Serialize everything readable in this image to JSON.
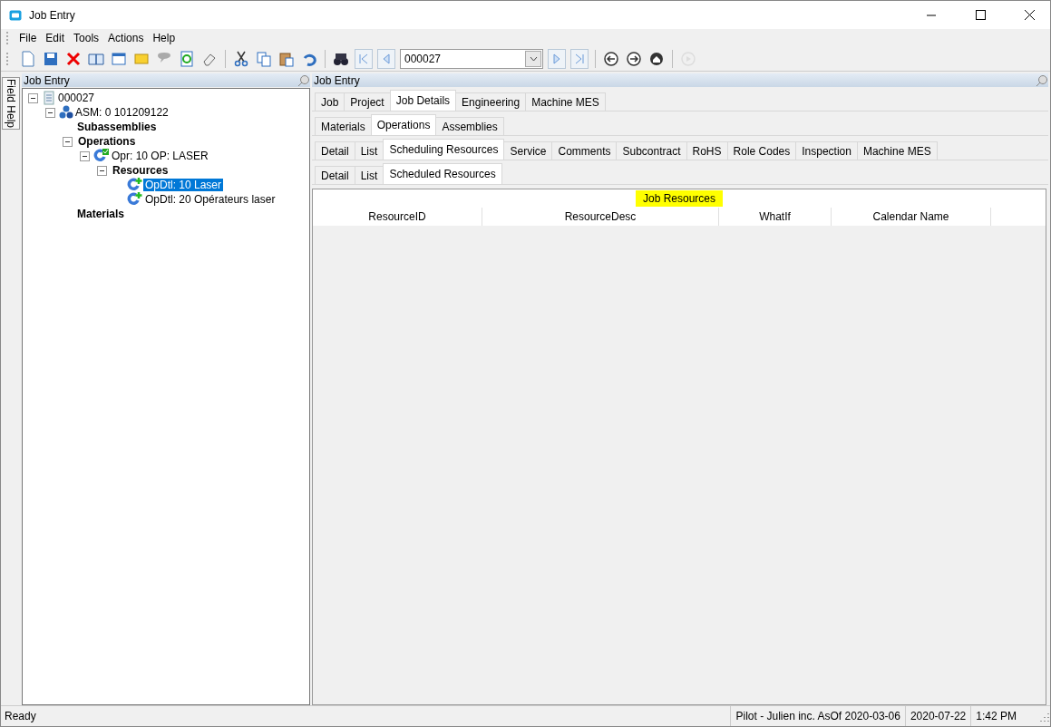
{
  "window": {
    "title": "Job Entry"
  },
  "menu": [
    "File",
    "Edit",
    "Tools",
    "Actions",
    "Help"
  ],
  "navigator": {
    "value": "000027"
  },
  "side_tab": "Field Help",
  "left_panel": {
    "title": "Job Entry",
    "tree": [
      {
        "label": "000027",
        "kind": "job",
        "selected": false,
        "expanded": true,
        "children": [
          {
            "label": "ASM: 0 101209122",
            "kind": "assembly",
            "selected": false,
            "expanded": true,
            "children": [
              {
                "label": "Subassemblies",
                "kind": "group",
                "selected": false
              },
              {
                "label": "Operations",
                "kind": "group",
                "selected": false,
                "expanded": true,
                "children": [
                  {
                    "label": "Opr: 10 OP: LASER",
                    "kind": "operation",
                    "selected": false,
                    "expanded": true,
                    "children": [
                      {
                        "label": "Resources",
                        "kind": "group",
                        "selected": false,
                        "expanded": true,
                        "children": [
                          {
                            "label": "OpDtl: 10 Laser",
                            "kind": "detail",
                            "selected": true
                          },
                          {
                            "label": "OpDtl: 20 Opérateurs laser",
                            "kind": "detail",
                            "selected": false
                          }
                        ]
                      }
                    ]
                  }
                ]
              },
              {
                "label": "Materials",
                "kind": "group",
                "selected": false
              }
            ]
          }
        ]
      }
    ]
  },
  "right_panel": {
    "title": "Job Entry",
    "tab_rows": [
      [
        {
          "label": "Job",
          "selected": false
        },
        {
          "label": "Project",
          "selected": false
        },
        {
          "label": "Job Details",
          "selected": true
        },
        {
          "label": "Engineering",
          "selected": false
        },
        {
          "label": "Machine MES",
          "selected": false
        }
      ],
      [
        {
          "label": "Materials",
          "selected": false
        },
        {
          "label": "Operations",
          "selected": true
        },
        {
          "label": "Assemblies",
          "selected": false
        }
      ],
      [
        {
          "label": "Detail",
          "selected": false
        },
        {
          "label": "List",
          "selected": false
        },
        {
          "label": "Scheduling Resources",
          "selected": true
        },
        {
          "label": "Service",
          "selected": false
        },
        {
          "label": "Comments",
          "selected": false
        },
        {
          "label": "Subcontract",
          "selected": false
        },
        {
          "label": "RoHS",
          "selected": false
        },
        {
          "label": "Role Codes",
          "selected": false
        },
        {
          "label": "Inspection",
          "selected": false
        },
        {
          "label": "Machine MES",
          "selected": false
        }
      ],
      [
        {
          "label": "Detail",
          "selected": false
        },
        {
          "label": "List",
          "selected": false
        },
        {
          "label": "Scheduled Resources",
          "selected": true
        }
      ]
    ],
    "grid": {
      "title": "Job Resources",
      "columns": [
        "ResourceID",
        "ResourceDesc",
        "WhatIf",
        "Calendar Name"
      ]
    }
  },
  "status_bar": {
    "message": "Ready",
    "panes": [
      "Pilot - Julien inc. AsOf 2020-03-06",
      "2020-07-22",
      "1:42 PM"
    ]
  }
}
